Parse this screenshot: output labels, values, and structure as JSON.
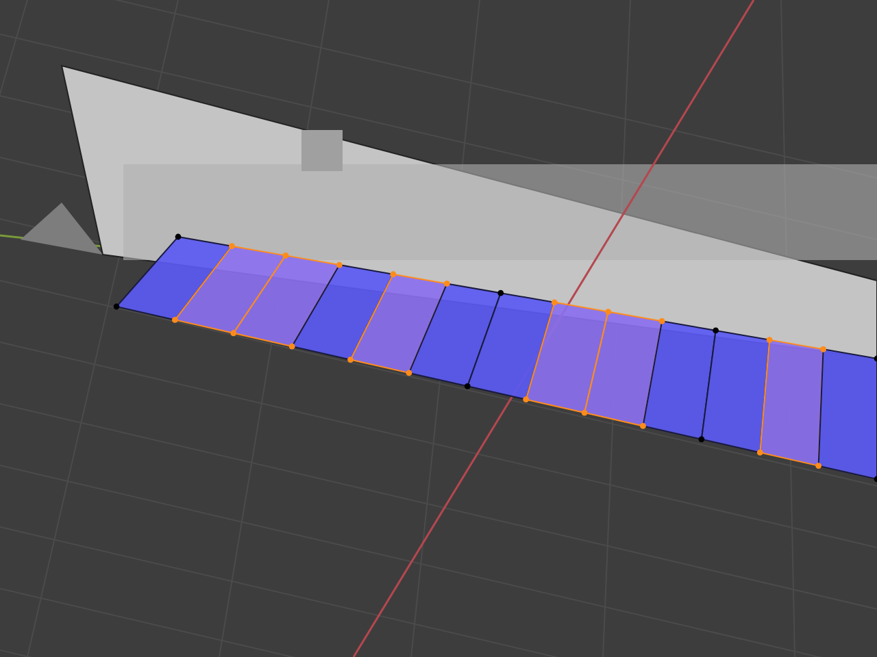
{
  "viewport": {
    "mesh_faces": [
      {
        "selected": false
      },
      {
        "selected": true
      },
      {
        "selected": true
      },
      {
        "selected": false
      },
      {
        "selected": true
      },
      {
        "selected": false
      },
      {
        "selected": false
      },
      {
        "selected": true
      },
      {
        "selected": true
      },
      {
        "selected": false
      },
      {
        "selected": false
      },
      {
        "selected": true
      },
      {
        "selected": false
      }
    ]
  }
}
